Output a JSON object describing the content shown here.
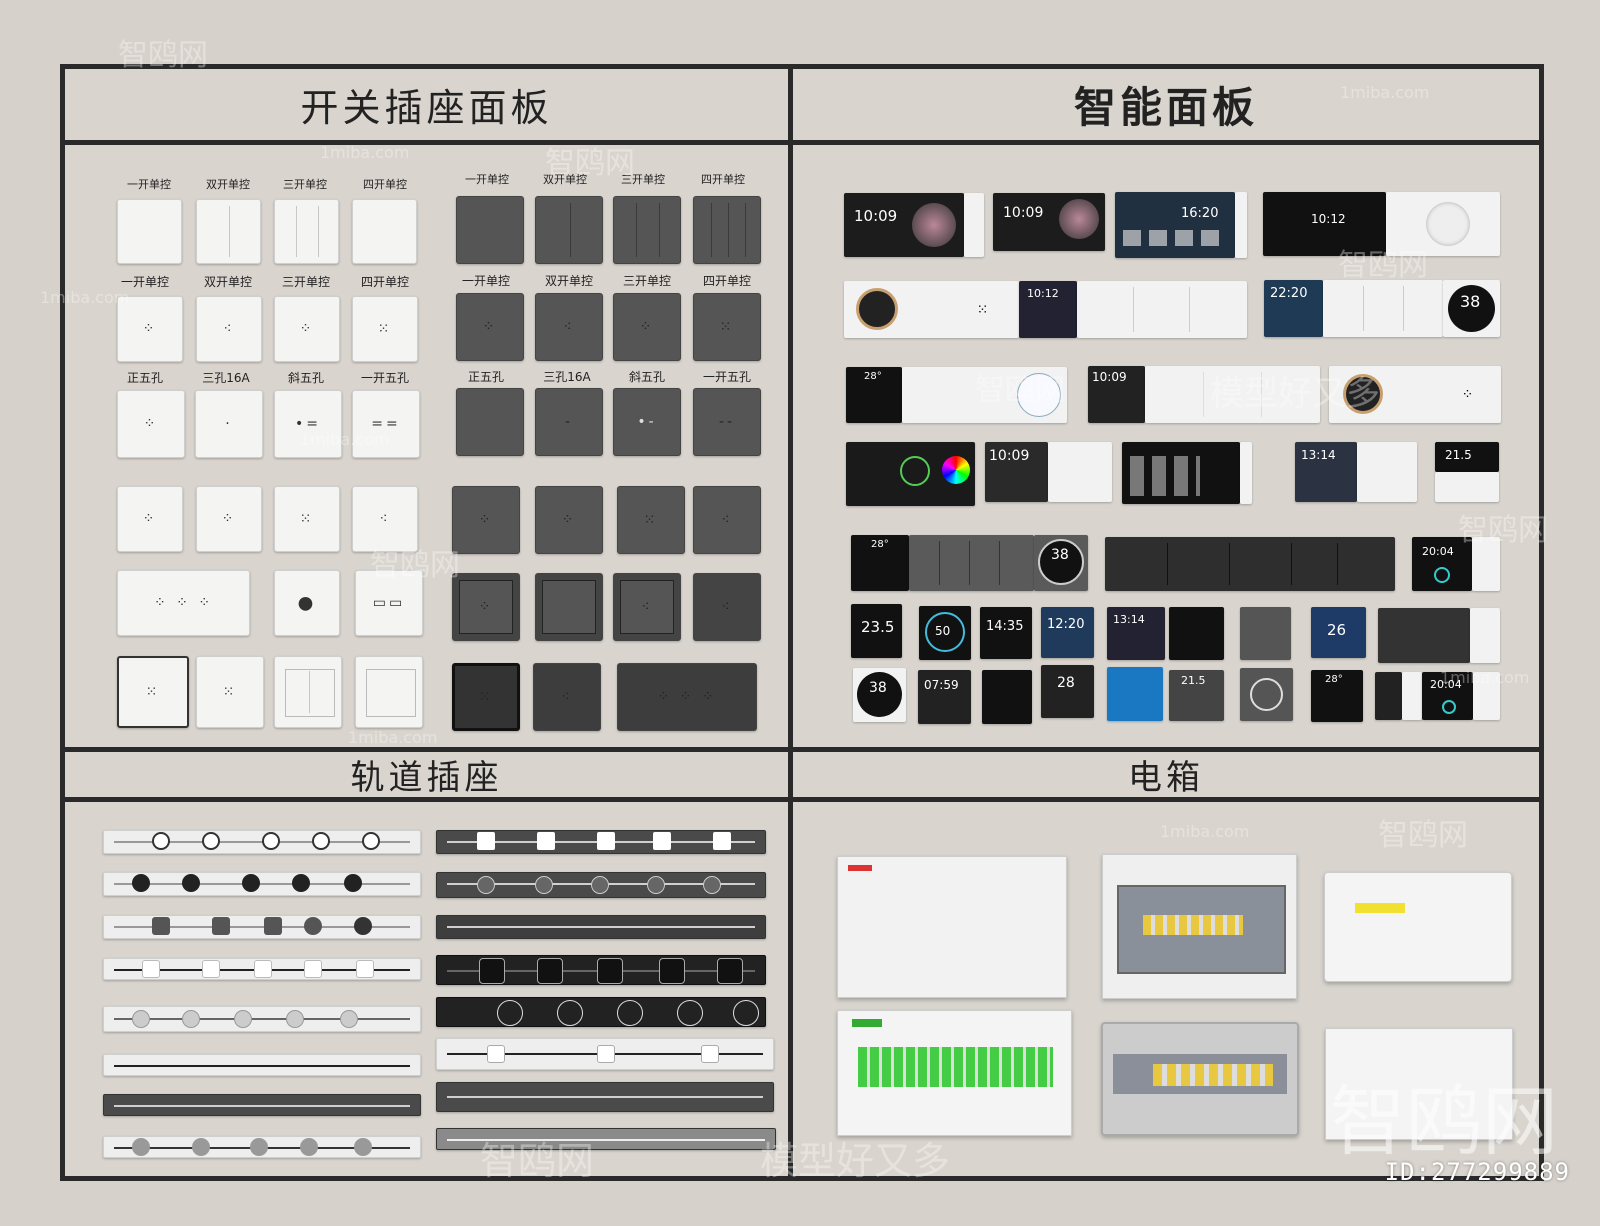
{
  "sections": {
    "switches": {
      "title": "开关插座面板"
    },
    "smart": {
      "title": "智能面板"
    },
    "track": {
      "title": "轨道插座"
    },
    "box": {
      "title": "电箱"
    }
  },
  "switch_labels": {
    "row1_white": [
      "一开单控",
      "双开单控",
      "三开单控",
      "四开单控"
    ],
    "row1_dark": [
      "一开单控",
      "双开单控",
      "三开单控",
      "四开单控"
    ],
    "row2_white": [
      "一开单控",
      "双开单控",
      "三开单控",
      "四开单控"
    ],
    "row2_dark": [
      "一开单控",
      "双开单控",
      "三开单控",
      "四开单控"
    ],
    "row3_white": [
      "正五孔",
      "三孔16A",
      "斜五孔",
      "一开五孔"
    ],
    "row3_dark": [
      "正五孔",
      "三孔16A",
      "斜五孔",
      "一开五孔"
    ]
  },
  "smart_panels": {
    "times": [
      "10:09",
      "10:09",
      "16:20",
      "10:12",
      "10:12",
      "22:20",
      "38",
      "28°",
      "10:09",
      "10:09",
      "13:14",
      "21.5",
      "28°",
      "38",
      "20:04",
      "23.5",
      "50",
      "14:35",
      "12:20",
      "13:14",
      "26",
      "38",
      "07:59",
      "28",
      "20:04",
      "21.5",
      "28°"
    ]
  },
  "watermarks": {
    "brand": "智鸥网",
    "site": "1miba.com",
    "slogan": "模型好又多",
    "id_text": "ID:277299889"
  },
  "colors": {
    "background": "#d6d1cb",
    "frame": "#2a2a2a",
    "white_panel": "#f4f4f2",
    "dark_panel": "#555555"
  }
}
